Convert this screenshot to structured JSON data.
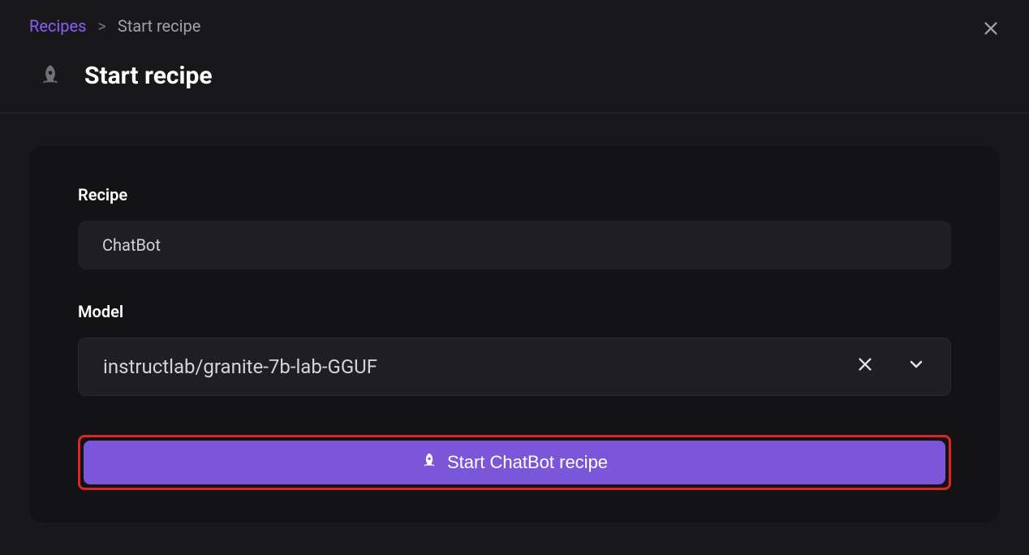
{
  "breadcrumb": {
    "root": "Recipes",
    "separator": ">",
    "current": "Start recipe"
  },
  "page": {
    "title": "Start recipe"
  },
  "form": {
    "recipe": {
      "label": "Recipe",
      "value": "ChatBot"
    },
    "model": {
      "label": "Model",
      "value": "instructlab/granite-7b-lab-GGUF"
    },
    "submit": {
      "label": "Start ChatBot recipe"
    }
  }
}
